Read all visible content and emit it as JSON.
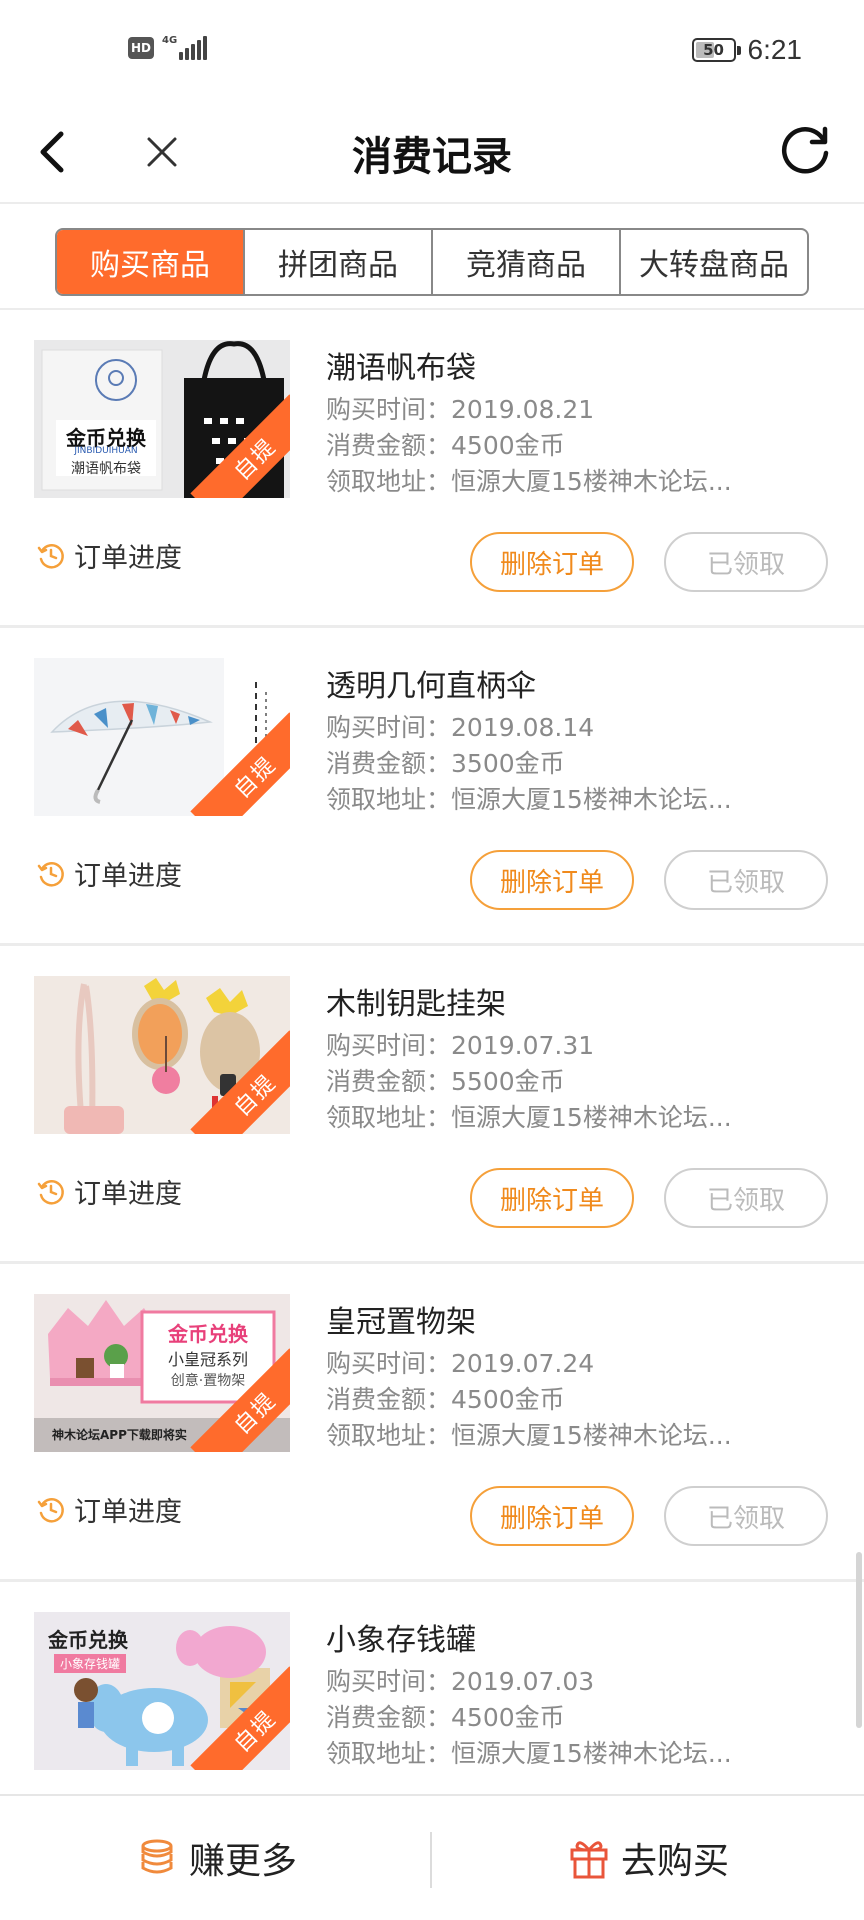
{
  "status_bar": {
    "hd": "HD",
    "network": "4G",
    "battery": "50",
    "battery_level": 0.5,
    "time": "6:21"
  },
  "nav": {
    "title": "消费记录",
    "back_icon": "chevron-left-icon",
    "close_icon": "close-icon",
    "refresh_icon": "refresh-icon"
  },
  "tabs": [
    {
      "label": "购买商品",
      "active": true
    },
    {
      "label": "拼团商品",
      "active": false
    },
    {
      "label": "竞猜商品",
      "active": false
    },
    {
      "label": "大转盘商品",
      "active": false
    }
  ],
  "orders": [
    {
      "name": "潮语帆布袋",
      "time_label": "购买时间：",
      "time": "2019.08.21",
      "amount_label": "消费金额：",
      "amount": "4500金币",
      "address_label": "领取地址：",
      "address": "恒源大厦15楼神木论坛...",
      "badge": "自提",
      "thumb_text_1": "金币兑换",
      "thumb_text_2": "JINBIDUIHUAN",
      "thumb_text_3": "潮语帆布袋"
    },
    {
      "name": "透明几何直柄伞",
      "time_label": "购买时间：",
      "time": "2019.08.14",
      "amount_label": "消费金额：",
      "amount": "3500金币",
      "address_label": "领取地址：",
      "address": "恒源大厦15楼神木论坛...",
      "badge": "自提"
    },
    {
      "name": "木制钥匙挂架",
      "time_label": "购买时间：",
      "time": "2019.07.31",
      "amount_label": "消费金额：",
      "amount": "5500金币",
      "address_label": "领取地址：",
      "address": "恒源大厦15楼神木论坛...",
      "badge": "自提"
    },
    {
      "name": "皇冠置物架",
      "time_label": "购买时间：",
      "time": "2019.07.24",
      "amount_label": "消费金额：",
      "amount": "4500金币",
      "address_label": "领取地址：",
      "address": "恒源大厦15楼神木论坛...",
      "badge": "自提",
      "thumb_text_1": "金币兑换",
      "thumb_text_2": "小皇冠系列",
      "thumb_text_3": "创意·置物架",
      "thumb_text_4": "神木论坛APP下载即将实"
    },
    {
      "name": "小象存钱罐",
      "time_label": "购买时间：",
      "time": "2019.07.03",
      "amount_label": "消费金额：",
      "amount": "4500金币",
      "address_label": "领取地址：",
      "address": "恒源大厦15楼神木论坛...",
      "badge": "自提",
      "thumb_text_1": "金币兑换",
      "thumb_text_2": "小象存钱罐"
    }
  ],
  "order_actions": {
    "progress_label": "订单进度",
    "progress_icon": "clock-history-icon",
    "delete_label": "删除订单",
    "received_label": "已领取"
  },
  "bottom_bar": {
    "earn_label": "赚更多",
    "earn_icon": "coin-stack-icon",
    "buy_label": "去购买",
    "buy_icon": "gift-icon"
  },
  "colors": {
    "accent": "#ff6b2c",
    "button_orange": "#f5a03a",
    "disabled_gray": "#cfcfcf",
    "text_gray": "#8a8a8a"
  }
}
